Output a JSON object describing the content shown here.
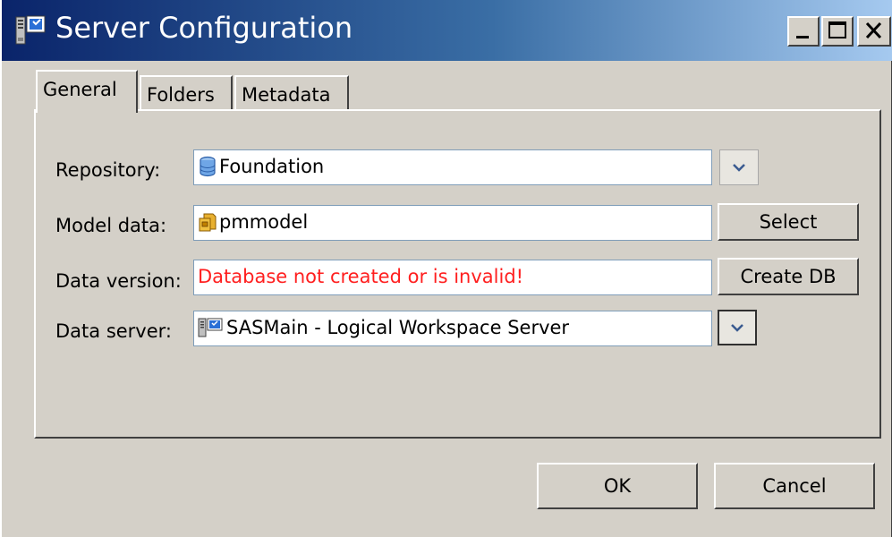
{
  "window": {
    "title": "Server Configuration",
    "icon": "server-icon",
    "controls": {
      "minimize": "minimize-icon",
      "maximize": "maximize-icon",
      "close": "close-icon"
    }
  },
  "tabs": [
    {
      "label": "General",
      "active": true
    },
    {
      "label": "Folders",
      "active": false
    },
    {
      "label": "Metadata",
      "active": false
    }
  ],
  "form": {
    "repository": {
      "label": "Repository:",
      "value": "Foundation",
      "icon": "database-icon"
    },
    "model_data": {
      "label": "Model data:",
      "value": "pmmodel",
      "icon": "model-icon",
      "button": "Select"
    },
    "data_version": {
      "label": "Data version:",
      "value": "Database not created or is invalid!",
      "value_color": "#ff1f1f",
      "button": "Create DB"
    },
    "data_server": {
      "label": "Data server:",
      "value": "SASMain - Logical Workspace Server",
      "icon": "server-icon"
    }
  },
  "buttons": {
    "ok": "OK",
    "cancel": "Cancel"
  },
  "colors": {
    "titlebar_start": "#0a246a",
    "titlebar_end": "#a6caf0",
    "error_text": "#ff1f1f",
    "face": "#d4d0c8"
  }
}
